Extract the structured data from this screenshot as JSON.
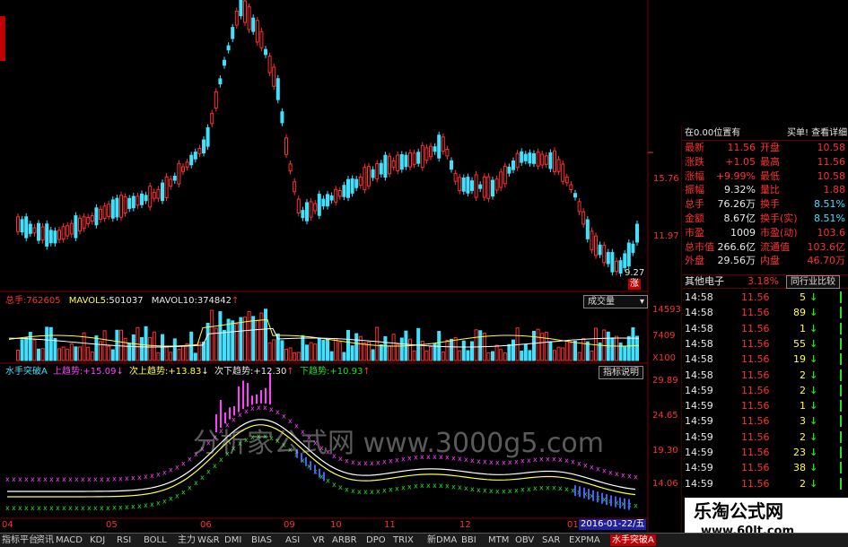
{
  "colors": {
    "up": "#ff3030",
    "down": "#40e0ff",
    "ma_white": "#ffffff",
    "ma_yellow": "#ffff40",
    "indicator_magenta": "#ff40ff",
    "indicator_green": "#20e020"
  },
  "price_axis": {
    "labels": [
      "15.76",
      "11.97"
    ],
    "low_marker": "9.27",
    "limit_tag": "涨"
  },
  "volume_bar": {
    "total_label": "总手:",
    "total_value": "762605",
    "ma5_label": "MAVOL5:",
    "ma5_value": "501037",
    "ma10_label": "MAVOL10:",
    "ma10_value": "374842",
    "selector": "成交量",
    "axis": [
      "14593",
      "7409",
      "X100"
    ]
  },
  "indicator_bar": {
    "name": "水手突破A",
    "up": "上趋势:",
    "up_value": "15.09",
    "sub_up": "次上趋势:",
    "sub_up_value": "13.83",
    "sub_down": "次下趋势:",
    "sub_down_value": "12.30",
    "down": "下趋势:",
    "down_value": "10.93",
    "help_button": "指标说明",
    "axis": [
      "29.89",
      "24.65",
      "19.30",
      "14.06"
    ]
  },
  "watermark": "分析家公式网 www.3000g5.com",
  "x_axis": {
    "labels": [
      "04",
      "05",
      "06",
      "09",
      "10",
      "11",
      "12",
      "01"
    ],
    "date_tag": "2016-01-22/五"
  },
  "quote": {
    "header_left": "在0.00位置有",
    "header_right": "买单!  查看详细",
    "rows": [
      {
        "l1": "最新",
        "v1": "11.56",
        "l2": "开盘",
        "v2": "10.58"
      },
      {
        "l1": "涨跌",
        "v1": "+1.05",
        "l2": "最高",
        "v2": "11.56"
      },
      {
        "l1": "涨幅",
        "v1": "+9.99%",
        "l2": "最低",
        "v2": "10.58"
      },
      {
        "l1": "振幅",
        "v1": "9.32%",
        "l2": "量比",
        "v2": "1.88"
      },
      {
        "l1": "总手",
        "v1": "76.26万",
        "l2": "换手",
        "v2": "8.51%"
      },
      {
        "l1": "金额",
        "v1": "8.67亿",
        "l2": "换手(实)",
        "v2": "8.51%"
      },
      {
        "l1": "市盈",
        "v1": "1009",
        "l2": "市盈(动)",
        "v2": "103.6"
      },
      {
        "l1": "总市值",
        "v1": "266.6亿",
        "l2": "流通值",
        "v2": "103.6亿"
      },
      {
        "l1": "外盘",
        "v1": "29.56万",
        "l2": "内盘",
        "v2": "46.70万"
      }
    ],
    "sector_name": "其他电子",
    "sector_change": "3.18%",
    "compare_button": "同行业比较",
    "ticks": [
      {
        "t": "14:58",
        "p": "11.56",
        "v": "5"
      },
      {
        "t": "14:58",
        "p": "11.56",
        "v": "89"
      },
      {
        "t": "14:58",
        "p": "11.56",
        "v": "1"
      },
      {
        "t": "14:58",
        "p": "11.56",
        "v": "55"
      },
      {
        "t": "14:58",
        "p": "11.56",
        "v": "19"
      },
      {
        "t": "14:58",
        "p": "11.56",
        "v": "2"
      },
      {
        "t": "14:59",
        "p": "11.56",
        "v": "2"
      },
      {
        "t": "14:59",
        "p": "11.56",
        "v": "1"
      },
      {
        "t": "14:59",
        "p": "11.56",
        "v": "3"
      },
      {
        "t": "14:59",
        "p": "11.56",
        "v": "2"
      },
      {
        "t": "14:59",
        "p": "11.56",
        "v": "23"
      },
      {
        "t": "14:59",
        "p": "11.56",
        "v": "38"
      },
      {
        "t": "14:59",
        "p": "11.56",
        "v": "2"
      }
    ]
  },
  "tabs": [
    "指标平台",
    "资讯",
    "MACD",
    "KDJ",
    "RSI",
    "BOLL",
    "主力",
    "W&R",
    "DMI",
    "BIAS",
    "ASI",
    "VR",
    "ARBR",
    "DPO",
    "TRIX",
    "新DMA",
    "BBI",
    "MTM",
    "OBV",
    "SAR",
    "EXPMA",
    "水手突破A"
  ],
  "logo": {
    "name": "乐淘公式网",
    "url": "www.60lt.com"
  }
}
